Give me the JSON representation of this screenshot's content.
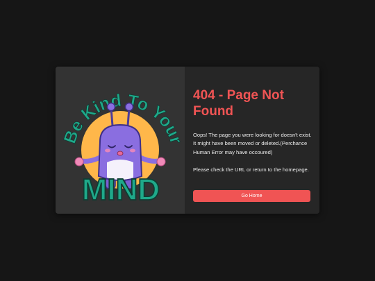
{
  "illustration": {
    "arc_text": "Be Kind To Your",
    "mind_text": "MIND"
  },
  "error": {
    "title": "404 - Page Not Found",
    "message_line1": "Oops! The page you were looking for doesn't exist.",
    "message_line2": "It might have been moved or deleted.(Perchance Human Error may have occoured)",
    "message_line3": "Please check the URL or return to the homepage."
  },
  "actions": {
    "home_label": "Go Home"
  },
  "colors": {
    "page_background": "#161616",
    "card_background": "#2b2b2b",
    "accent": "#f05454",
    "sun": "#ffb74a",
    "mind_green": "#1fa98a",
    "monster_purple": "#8a6ee0"
  }
}
